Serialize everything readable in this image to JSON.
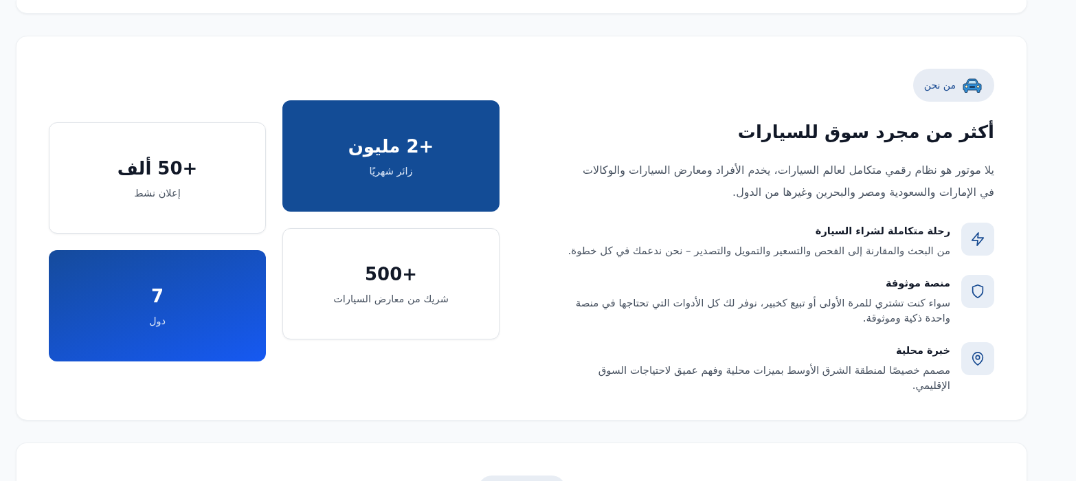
{
  "about": {
    "badge": {
      "label": "من نحن"
    },
    "heading": "أكثر من مجرد سوق للسيارات",
    "intro": "يلا موتور هو نظام رقمي متكامل لعالم السيارات، يخدم الأفراد ومعارض السيارات والوكالات في الإمارات والسعودية ومصر والبحرين وغيرها من الدول.",
    "features": [
      {
        "title": "رحلة متكاملة لشراء السيارة",
        "description": "من البحث والمقارنة إلى الفحص والتسعير والتمويل والتصدير – نحن ندعمك في كل خطوة."
      },
      {
        "title": "منصة موثوقة",
        "description": "سواء كنت تشتري للمرة الأولى أو تبيع كخبير، نوفر لك كل الأدوات التي تحتاجها في منصة واحدة ذكية وموثوقة."
      },
      {
        "title": "خبرة محلية",
        "description": "مصمم خصيصًا لمنطقة الشرق الأوسط بميزات محلية وفهم عميق لاحتياجات السوق الإقليمي."
      }
    ],
    "stats": [
      {
        "kind": "solid",
        "value": "+2 مليون",
        "label": "زائر شهريًا"
      },
      {
        "kind": "plain",
        "value": "+50 ألف",
        "label": "إعلان نشط"
      },
      {
        "kind": "plain",
        "value": "+500",
        "label": "شريك من معارض السيارات"
      },
      {
        "kind": "gradient",
        "value": "7",
        "label": "دول"
      }
    ]
  }
}
